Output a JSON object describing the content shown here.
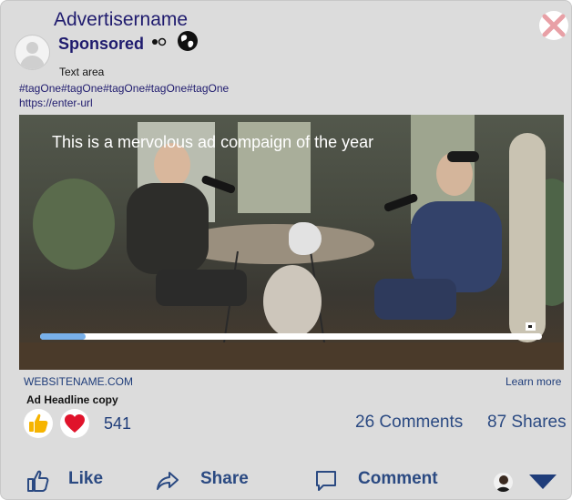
{
  "advertiser": {
    "name": "Advertisername",
    "sponsored": "Sponsored"
  },
  "icons": {
    "avatar": "user-avatar-placeholder",
    "dots": "dots-icon",
    "globe": "globe-icon",
    "close": "close-icon"
  },
  "post": {
    "text": "Text area",
    "hashtags": "#tagOne#tagOne#tagOne#tagOne#tagOne",
    "url": "https://enter-url"
  },
  "video": {
    "title": "This is a mervolous ad compaign of the year",
    "progress": 0.09
  },
  "link": {
    "website": "WEBSITENAME.COM",
    "cta": "Learn more",
    "headline": "Ad Headline copy"
  },
  "engagement": {
    "reactions": "541",
    "comments": "26 Comments",
    "shares": "87 Shares"
  },
  "actions": {
    "like": "Like",
    "share": "Share",
    "comment": "Comment"
  },
  "colors": {
    "brand": "#1f1b6e",
    "link": "#2b4a82",
    "progress": "#78b0ea",
    "close": "#e8a0a6",
    "love": "#e0132b",
    "like": "#f6b400"
  }
}
